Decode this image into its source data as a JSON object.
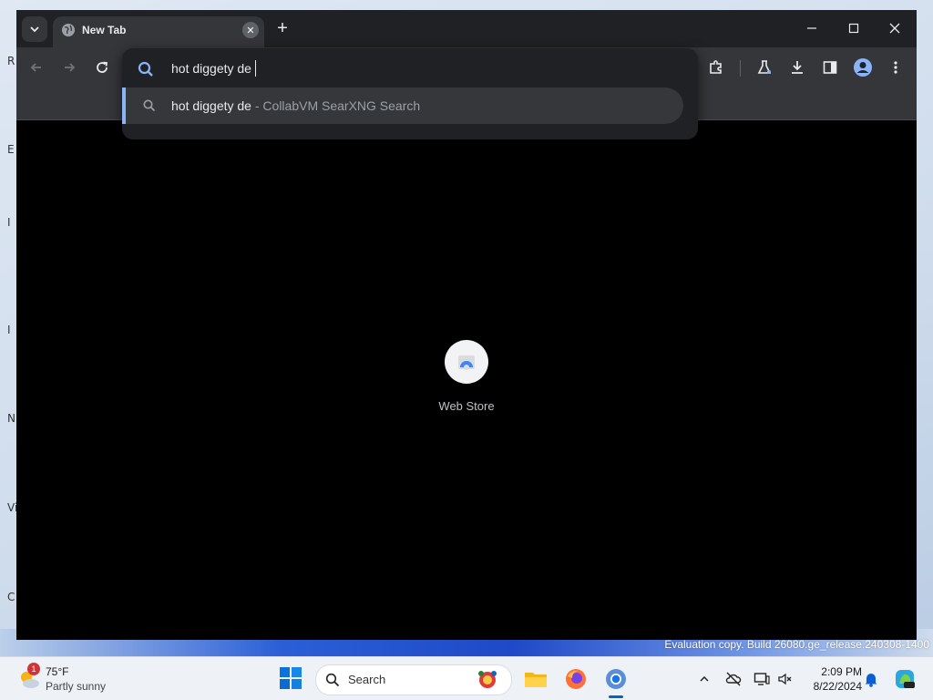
{
  "browser": {
    "tab": {
      "title": "New Tab"
    },
    "omnibox": {
      "value": "hot diggety de",
      "suggestion": {
        "query": "hot diggety de",
        "separator": " - ",
        "source": "CollabVM SearXNG Search"
      }
    },
    "shortcuts": [
      {
        "label": "Web Store"
      }
    ]
  },
  "desktop": {
    "edge_letters": [
      "R",
      "E",
      "I",
      "I",
      "N",
      "Vi",
      "C"
    ],
    "watermark": "Evaluation copy. Build 26080.ge_release.240308-1400"
  },
  "taskbar": {
    "weather": {
      "temp": "75°F",
      "desc": "Partly sunny",
      "badge": "1"
    },
    "search_label": "Search",
    "clock": {
      "time": "2:09 PM",
      "date": "8/22/2024"
    }
  },
  "colors": {
    "accent": "#8ab4f8",
    "chrome_dark": "#202124",
    "toolbar": "#35363a",
    "taskbar": "#eef2f7"
  }
}
